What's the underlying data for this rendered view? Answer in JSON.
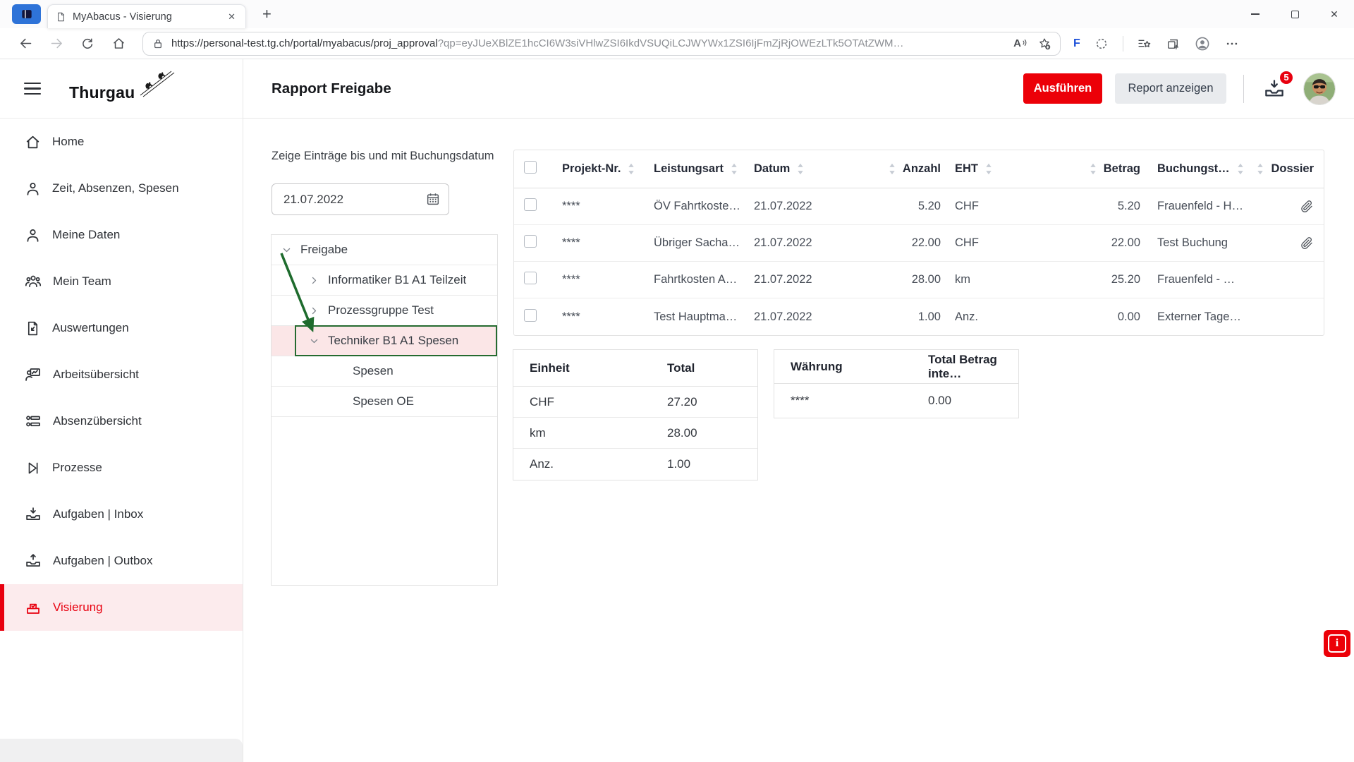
{
  "browser": {
    "tab_title": "MyAbacus - Visierung",
    "close_tab_glyph": "✕",
    "new_tab_glyph": "+",
    "close_window_glyph": "✕",
    "url_path": "https://personal-test.tg.ch/portal/myabacus/proj_approval",
    "url_query": "?qp=eyJUeXBlZE1hcCI6W3siVHlwZSI6IkdVSUQiLCJWYWx1ZSI6IjFmZjRjOWEzLTk5OTAtZWM…",
    "read_aloud_label": "A",
    "extension_f_label": "F"
  },
  "sidebar": {
    "brand": "Thurgau",
    "items": [
      {
        "label": "Home",
        "icon": "home-icon"
      },
      {
        "label": "Zeit, Absenzen, Spesen",
        "icon": "person-icon"
      },
      {
        "label": "Meine Daten",
        "icon": "person-icon"
      },
      {
        "label": "Mein Team",
        "icon": "team-icon"
      },
      {
        "label": "Auswertungen",
        "icon": "report-doc-icon"
      },
      {
        "label": "Arbeitsübersicht",
        "icon": "work-overview-icon"
      },
      {
        "label": "Absenzübersicht",
        "icon": "absence-overview-icon"
      },
      {
        "label": "Prozesse",
        "icon": "process-icon"
      },
      {
        "label": "Aufgaben | Inbox",
        "icon": "inbox-tray-icon"
      },
      {
        "label": "Aufgaben | Outbox",
        "icon": "outbox-tray-icon"
      },
      {
        "label": "Visierung",
        "icon": "approval-box-icon",
        "active": true
      }
    ]
  },
  "header": {
    "title": "Rapport Freigabe",
    "run_button": "Ausführen",
    "report_button": "Report anzeigen",
    "notification_count": "5"
  },
  "filter": {
    "label": "Zeige Einträge bis und mit Buchungsdatum",
    "date_value": "21.07.2022"
  },
  "tree": {
    "root_label": "Freigabe",
    "items": [
      {
        "label": "Informatiker B1 A1 Teilzeit",
        "state": "collapsed"
      },
      {
        "label": "Prozessgruppe Test",
        "state": "collapsed"
      },
      {
        "label": "Techniker B1 A1 Spesen",
        "state": "expanded",
        "highlighted": true
      },
      {
        "label": "Spesen"
      },
      {
        "label": "Spesen OE"
      }
    ]
  },
  "table": {
    "columns": [
      "Projekt-Nr.",
      "Leistungsart",
      "Datum",
      "Anzahl",
      "EHT",
      "Betrag",
      "Buchungst…",
      "Dossier"
    ],
    "rows": [
      {
        "projekt": "****",
        "leistungsart": "ÖV Fahrtkoste…",
        "datum": "21.07.2022",
        "anzahl": "5.20",
        "eht": "CHF",
        "betrag": "5.20",
        "buchungstext": "Frauenfeld - H…",
        "has_attachment": true
      },
      {
        "projekt": "****",
        "leistungsart": "Übriger Sacha…",
        "datum": "21.07.2022",
        "anzahl": "22.00",
        "eht": "CHF",
        "betrag": "22.00",
        "buchungstext": "Test Buchung",
        "has_attachment": true
      },
      {
        "projekt": "****",
        "leistungsart": "Fahrtkosten A…",
        "datum": "21.07.2022",
        "anzahl": "28.00",
        "eht": "km",
        "betrag": "25.20",
        "buchungstext": "Frauenfeld - …",
        "has_attachment": false
      },
      {
        "projekt": "****",
        "leistungsart": "Test Hauptma…",
        "datum": "21.07.2022",
        "anzahl": "1.00",
        "eht": "Anz.",
        "betrag": "0.00",
        "buchungstext": "Externer Tage…",
        "has_attachment": false
      }
    ]
  },
  "unit_totals": {
    "col1_header": "Einheit",
    "col2_header": "Total",
    "rows": [
      {
        "unit": "CHF",
        "total": "27.20"
      },
      {
        "unit": "km",
        "total": "28.00"
      },
      {
        "unit": "Anz.",
        "total": "1.00"
      }
    ]
  },
  "currency_totals": {
    "col1_header": "Währung",
    "col2_header": "Total Betrag inte…",
    "rows": [
      {
        "currency": "****",
        "total": "0.00"
      }
    ]
  },
  "feedback_button": {
    "label": "i"
  }
}
